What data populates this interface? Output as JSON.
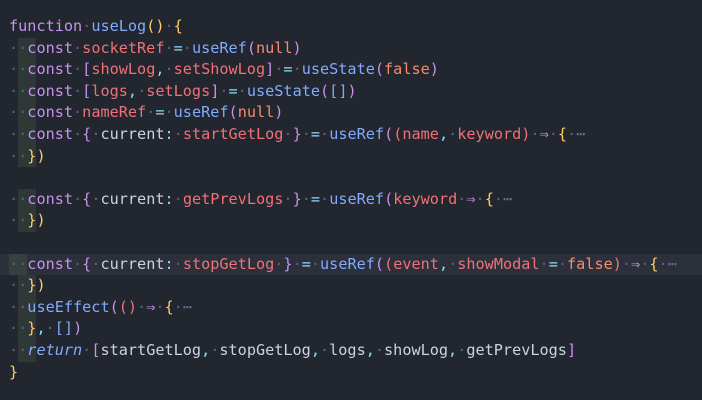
{
  "theme": {
    "background": "#22262f",
    "current_line": "#2b303b",
    "colors": {
      "keyword": "#c792ea",
      "function": "#82aaff",
      "variable": "#f07178",
      "plain": "#cdd3de",
      "punct": "#89ddff",
      "bracket": "#ffcb6b",
      "paren2": "#c792ea",
      "literal": "#f78c6c",
      "comment": "#697098",
      "ws": "#5c6370"
    }
  },
  "lines": [
    {
      "guide": false,
      "current": false,
      "tokens": [
        {
          "t": "function",
          "c": "keyword"
        },
        {
          "t": "·",
          "c": "ws"
        },
        {
          "t": "useLog",
          "c": "function"
        },
        {
          "t": "()",
          "c": "bracket"
        },
        {
          "t": "·",
          "c": "ws"
        },
        {
          "t": "{",
          "c": "bracket"
        }
      ]
    },
    {
      "guide": true,
      "current": false,
      "tokens": [
        {
          "t": "··",
          "c": "ws"
        },
        {
          "t": "const",
          "c": "keyword"
        },
        {
          "t": "·",
          "c": "ws"
        },
        {
          "t": "socketRef",
          "c": "variable"
        },
        {
          "t": "·",
          "c": "ws"
        },
        {
          "t": "=",
          "c": "punct"
        },
        {
          "t": "·",
          "c": "ws"
        },
        {
          "t": "useRef",
          "c": "function"
        },
        {
          "t": "(",
          "c": "paren2"
        },
        {
          "t": "null",
          "c": "literal"
        },
        {
          "t": ")",
          "c": "paren2"
        }
      ]
    },
    {
      "guide": true,
      "current": false,
      "tokens": [
        {
          "t": "··",
          "c": "ws"
        },
        {
          "t": "const",
          "c": "keyword"
        },
        {
          "t": "·",
          "c": "ws"
        },
        {
          "t": "[",
          "c": "paren2"
        },
        {
          "t": "showLog",
          "c": "variable"
        },
        {
          "t": ",",
          "c": "punct"
        },
        {
          "t": "·",
          "c": "ws"
        },
        {
          "t": "setShowLog",
          "c": "variable"
        },
        {
          "t": "]",
          "c": "paren2"
        },
        {
          "t": "·",
          "c": "ws"
        },
        {
          "t": "=",
          "c": "punct"
        },
        {
          "t": "·",
          "c": "ws"
        },
        {
          "t": "useState",
          "c": "function"
        },
        {
          "t": "(",
          "c": "paren2"
        },
        {
          "t": "false",
          "c": "literal"
        },
        {
          "t": ")",
          "c": "paren2"
        }
      ]
    },
    {
      "guide": true,
      "current": false,
      "tokens": [
        {
          "t": "··",
          "c": "ws"
        },
        {
          "t": "const",
          "c": "keyword"
        },
        {
          "t": "·",
          "c": "ws"
        },
        {
          "t": "[",
          "c": "paren2"
        },
        {
          "t": "logs",
          "c": "variable"
        },
        {
          "t": ",",
          "c": "punct"
        },
        {
          "t": "·",
          "c": "ws"
        },
        {
          "t": "setLogs",
          "c": "variable"
        },
        {
          "t": "]",
          "c": "paren2"
        },
        {
          "t": "·",
          "c": "ws"
        },
        {
          "t": "=",
          "c": "punct"
        },
        {
          "t": "·",
          "c": "ws"
        },
        {
          "t": "useState",
          "c": "function"
        },
        {
          "t": "(",
          "c": "paren2"
        },
        {
          "t": "[]",
          "c": "function"
        },
        {
          "t": ")",
          "c": "paren2"
        }
      ]
    },
    {
      "guide": true,
      "current": false,
      "tokens": [
        {
          "t": "··",
          "c": "ws"
        },
        {
          "t": "const",
          "c": "keyword"
        },
        {
          "t": "·",
          "c": "ws"
        },
        {
          "t": "nameRef",
          "c": "variable"
        },
        {
          "t": "·",
          "c": "ws"
        },
        {
          "t": "=",
          "c": "punct"
        },
        {
          "t": "·",
          "c": "ws"
        },
        {
          "t": "useRef",
          "c": "function"
        },
        {
          "t": "(",
          "c": "paren2"
        },
        {
          "t": "null",
          "c": "literal"
        },
        {
          "t": ")",
          "c": "paren2"
        }
      ]
    },
    {
      "guide": true,
      "current": false,
      "tokens": [
        {
          "t": "··",
          "c": "ws"
        },
        {
          "t": "const",
          "c": "keyword"
        },
        {
          "t": "·",
          "c": "ws"
        },
        {
          "t": "{",
          "c": "paren2"
        },
        {
          "t": "·",
          "c": "ws"
        },
        {
          "t": "current",
          "c": "plain"
        },
        {
          "t": ":",
          "c": "punct"
        },
        {
          "t": "·",
          "c": "ws"
        },
        {
          "t": "startGetLog",
          "c": "variable"
        },
        {
          "t": "·",
          "c": "ws"
        },
        {
          "t": "}",
          "c": "paren2"
        },
        {
          "t": "·",
          "c": "ws"
        },
        {
          "t": "=",
          "c": "punct"
        },
        {
          "t": "·",
          "c": "ws"
        },
        {
          "t": "useRef",
          "c": "function"
        },
        {
          "t": "(",
          "c": "paren2"
        },
        {
          "t": "(",
          "c": "variable"
        },
        {
          "t": "name",
          "c": "variable"
        },
        {
          "t": ",",
          "c": "punct"
        },
        {
          "t": "·",
          "c": "ws"
        },
        {
          "t": "keyword",
          "c": "variable"
        },
        {
          "t": ")",
          "c": "variable"
        },
        {
          "t": "·",
          "c": "ws"
        },
        {
          "t": "⇒",
          "c": "keyword"
        },
        {
          "t": "·",
          "c": "ws"
        },
        {
          "t": "{",
          "c": "bracket"
        },
        {
          "t": "·",
          "c": "ws"
        },
        {
          "t": "⋯",
          "c": "comment"
        }
      ]
    },
    {
      "guide": true,
      "current": false,
      "tokens": [
        {
          "t": "··",
          "c": "ws"
        },
        {
          "t": "})",
          "c": "bracket"
        }
      ]
    },
    {
      "guide": false,
      "current": false,
      "tokens": []
    },
    {
      "guide": true,
      "current": false,
      "tokens": [
        {
          "t": "··",
          "c": "ws"
        },
        {
          "t": "const",
          "c": "keyword"
        },
        {
          "t": "·",
          "c": "ws"
        },
        {
          "t": "{",
          "c": "paren2"
        },
        {
          "t": "·",
          "c": "ws"
        },
        {
          "t": "current",
          "c": "plain"
        },
        {
          "t": ":",
          "c": "punct"
        },
        {
          "t": "·",
          "c": "ws"
        },
        {
          "t": "getPrevLogs",
          "c": "variable"
        },
        {
          "t": "·",
          "c": "ws"
        },
        {
          "t": "}",
          "c": "paren2"
        },
        {
          "t": "·",
          "c": "ws"
        },
        {
          "t": "=",
          "c": "punct"
        },
        {
          "t": "·",
          "c": "ws"
        },
        {
          "t": "useRef",
          "c": "function"
        },
        {
          "t": "(",
          "c": "paren2"
        },
        {
          "t": "keyword",
          "c": "variable"
        },
        {
          "t": "·",
          "c": "ws"
        },
        {
          "t": "⇒",
          "c": "keyword"
        },
        {
          "t": "·",
          "c": "ws"
        },
        {
          "t": "{",
          "c": "bracket"
        },
        {
          "t": "·",
          "c": "ws"
        },
        {
          "t": "⋯",
          "c": "comment"
        }
      ]
    },
    {
      "guide": true,
      "current": false,
      "tokens": [
        {
          "t": "··",
          "c": "ws"
        },
        {
          "t": "})",
          "c": "bracket"
        }
      ]
    },
    {
      "guide": false,
      "current": false,
      "tokens": []
    },
    {
      "guide": true,
      "current": true,
      "tokens": [
        {
          "t": "··",
          "c": "ws"
        },
        {
          "t": "const",
          "c": "keyword"
        },
        {
          "t": "·",
          "c": "ws"
        },
        {
          "t": "{",
          "c": "paren2"
        },
        {
          "t": "·",
          "c": "ws"
        },
        {
          "t": "current",
          "c": "plain"
        },
        {
          "t": ":",
          "c": "punct"
        },
        {
          "t": "·",
          "c": "ws"
        },
        {
          "t": "stopGetLog",
          "c": "variable"
        },
        {
          "t": "·",
          "c": "ws"
        },
        {
          "t": "}",
          "c": "paren2"
        },
        {
          "t": "·",
          "c": "ws"
        },
        {
          "t": "=",
          "c": "punct"
        },
        {
          "t": "·",
          "c": "ws"
        },
        {
          "t": "useRef",
          "c": "function"
        },
        {
          "t": "(",
          "c": "paren2"
        },
        {
          "t": "(",
          "c": "variable"
        },
        {
          "t": "event",
          "c": "variable"
        },
        {
          "t": ",",
          "c": "punct"
        },
        {
          "t": "·",
          "c": "ws"
        },
        {
          "t": "showModal",
          "c": "variable"
        },
        {
          "t": "·",
          "c": "ws"
        },
        {
          "t": "=",
          "c": "punct"
        },
        {
          "t": "·",
          "c": "ws"
        },
        {
          "t": "false",
          "c": "literal"
        },
        {
          "t": ")",
          "c": "variable"
        },
        {
          "t": "·",
          "c": "ws"
        },
        {
          "t": "⇒",
          "c": "keyword"
        },
        {
          "t": "·",
          "c": "ws"
        },
        {
          "t": "{",
          "c": "bracket"
        },
        {
          "t": "·",
          "c": "ws"
        },
        {
          "t": "⋯",
          "c": "comment"
        }
      ]
    },
    {
      "guide": true,
      "current": false,
      "tokens": [
        {
          "t": "··",
          "c": "ws"
        },
        {
          "t": "})",
          "c": "bracket"
        }
      ]
    },
    {
      "guide": true,
      "current": false,
      "tokens": [
        {
          "t": "··",
          "c": "ws"
        },
        {
          "t": "useEffect",
          "c": "function"
        },
        {
          "t": "(",
          "c": "paren2"
        },
        {
          "t": "()",
          "c": "variable"
        },
        {
          "t": "·",
          "c": "ws"
        },
        {
          "t": "⇒",
          "c": "keyword"
        },
        {
          "t": "·",
          "c": "ws"
        },
        {
          "t": "{",
          "c": "bracket"
        },
        {
          "t": "·",
          "c": "ws"
        },
        {
          "t": "⋯",
          "c": "comment"
        }
      ]
    },
    {
      "guide": true,
      "current": false,
      "tokens": [
        {
          "t": "··",
          "c": "ws"
        },
        {
          "t": "}",
          "c": "bracket"
        },
        {
          "t": ",",
          "c": "punct"
        },
        {
          "t": "·",
          "c": "ws"
        },
        {
          "t": "[]",
          "c": "function"
        },
        {
          "t": ")",
          "c": "paren2"
        }
      ]
    },
    {
      "guide": true,
      "current": false,
      "tokens": [
        {
          "t": "··",
          "c": "ws"
        },
        {
          "t": "return",
          "c": "function",
          "italic": true
        },
        {
          "t": "·",
          "c": "ws"
        },
        {
          "t": "[",
          "c": "paren2"
        },
        {
          "t": "startGetLog",
          "c": "plain"
        },
        {
          "t": ",",
          "c": "punct"
        },
        {
          "t": "·",
          "c": "ws"
        },
        {
          "t": "stopGetLog",
          "c": "plain"
        },
        {
          "t": ",",
          "c": "punct"
        },
        {
          "t": "·",
          "c": "ws"
        },
        {
          "t": "logs",
          "c": "plain"
        },
        {
          "t": ",",
          "c": "punct"
        },
        {
          "t": "·",
          "c": "ws"
        },
        {
          "t": "showLog",
          "c": "plain"
        },
        {
          "t": ",",
          "c": "punct"
        },
        {
          "t": "·",
          "c": "ws"
        },
        {
          "t": "getPrevLogs",
          "c": "plain"
        },
        {
          "t": "]",
          "c": "paren2"
        }
      ]
    },
    {
      "guide": false,
      "current": false,
      "tokens": [
        {
          "t": "}",
          "c": "bracket"
        }
      ]
    }
  ]
}
